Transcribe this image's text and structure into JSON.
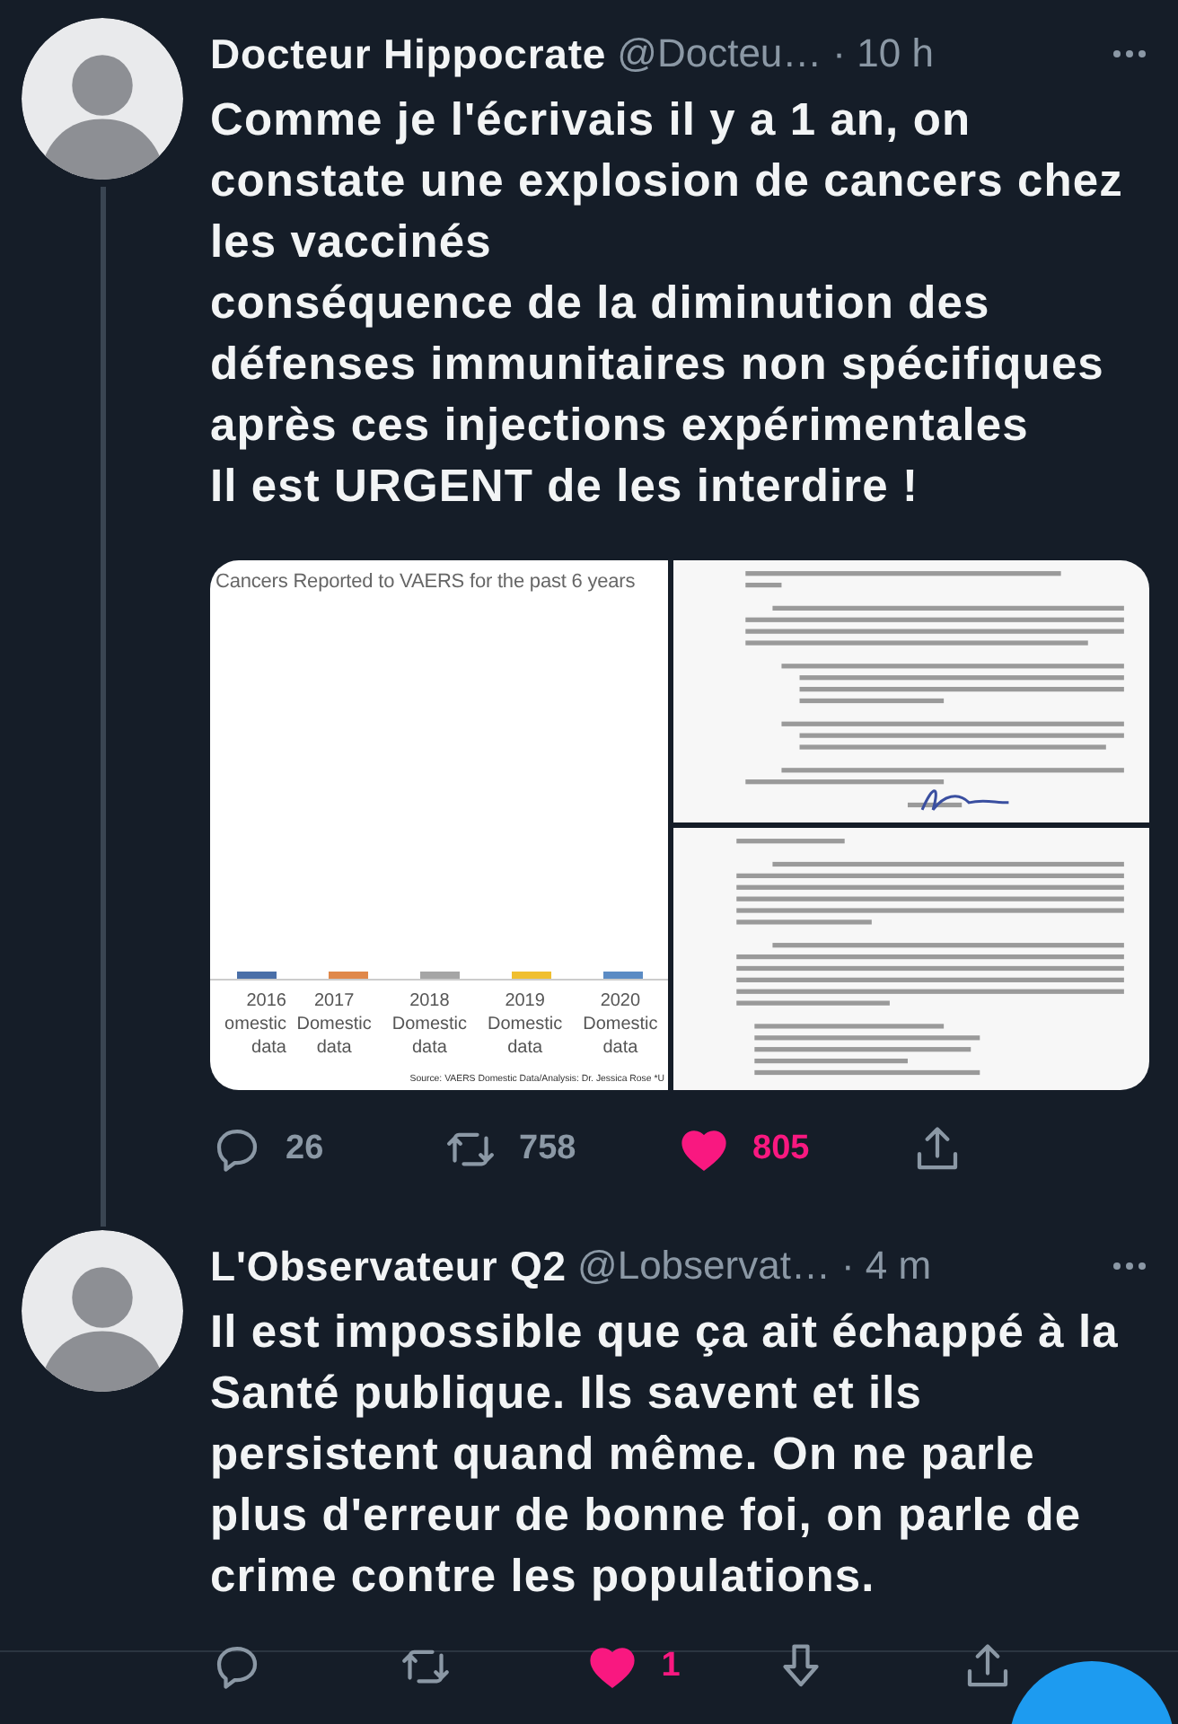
{
  "tweets": [
    {
      "name": "Docteur Hippocrate",
      "handle": "@Docteu…",
      "time": "· 10 h",
      "thread_continues": true,
      "text": "Comme je l'écrivais il y a 1 an, on constate une explosion de cancers chez les vaccinés\nconséquence de la diminution des défenses immunitaires non spécifiques après ces injections expérimentales\nIl est URGENT de les interdire !",
      "media": {
        "chart_title": "Cancers Reported to VAERS for the past 6 years",
        "source": "Source: VAERS Domestic Data/Analysis: Dr. Jessica Rose *U",
        "categories": [
          {
            "lines": [
              "2016",
              "omestic",
              "data"
            ],
            "color": "#4a6fa8"
          },
          {
            "lines": [
              "2017",
              "Domestic",
              "data"
            ],
            "color": "#e0884a"
          },
          {
            "lines": [
              "2018",
              "Domestic",
              "data"
            ],
            "color": "#a5a5a5"
          },
          {
            "lines": [
              "2019",
              "Domestic",
              "data"
            ],
            "color": "#f0bf30"
          },
          {
            "lines": [
              "2020",
              "Domestic",
              "data"
            ],
            "color": "#5b8bc4"
          }
        ],
        "documents": [
          {
            "kind": "letter-end"
          },
          {
            "kind": "letter-start"
          }
        ]
      },
      "actions": [
        {
          "kind": "reply",
          "count": "26"
        },
        {
          "kind": "retweet",
          "count": "758"
        },
        {
          "kind": "like",
          "count": "805",
          "liked": true
        },
        {
          "kind": "share"
        }
      ]
    },
    {
      "name": "L'Observateur Q2",
      "handle": "@Lobservat…",
      "time": "· 4 m",
      "thread_continues": false,
      "text": "Il est impossible que ça ait échappé à la Santé publique. Ils savent et ils persistent quand même. On ne parle plus d'erreur de bonne foi, on parle de crime contre les populations.",
      "actions": [
        {
          "kind": "reply"
        },
        {
          "kind": "retweet"
        },
        {
          "kind": "like",
          "count": "1",
          "liked": true
        },
        {
          "kind": "downvote"
        },
        {
          "kind": "share"
        }
      ]
    }
  ]
}
